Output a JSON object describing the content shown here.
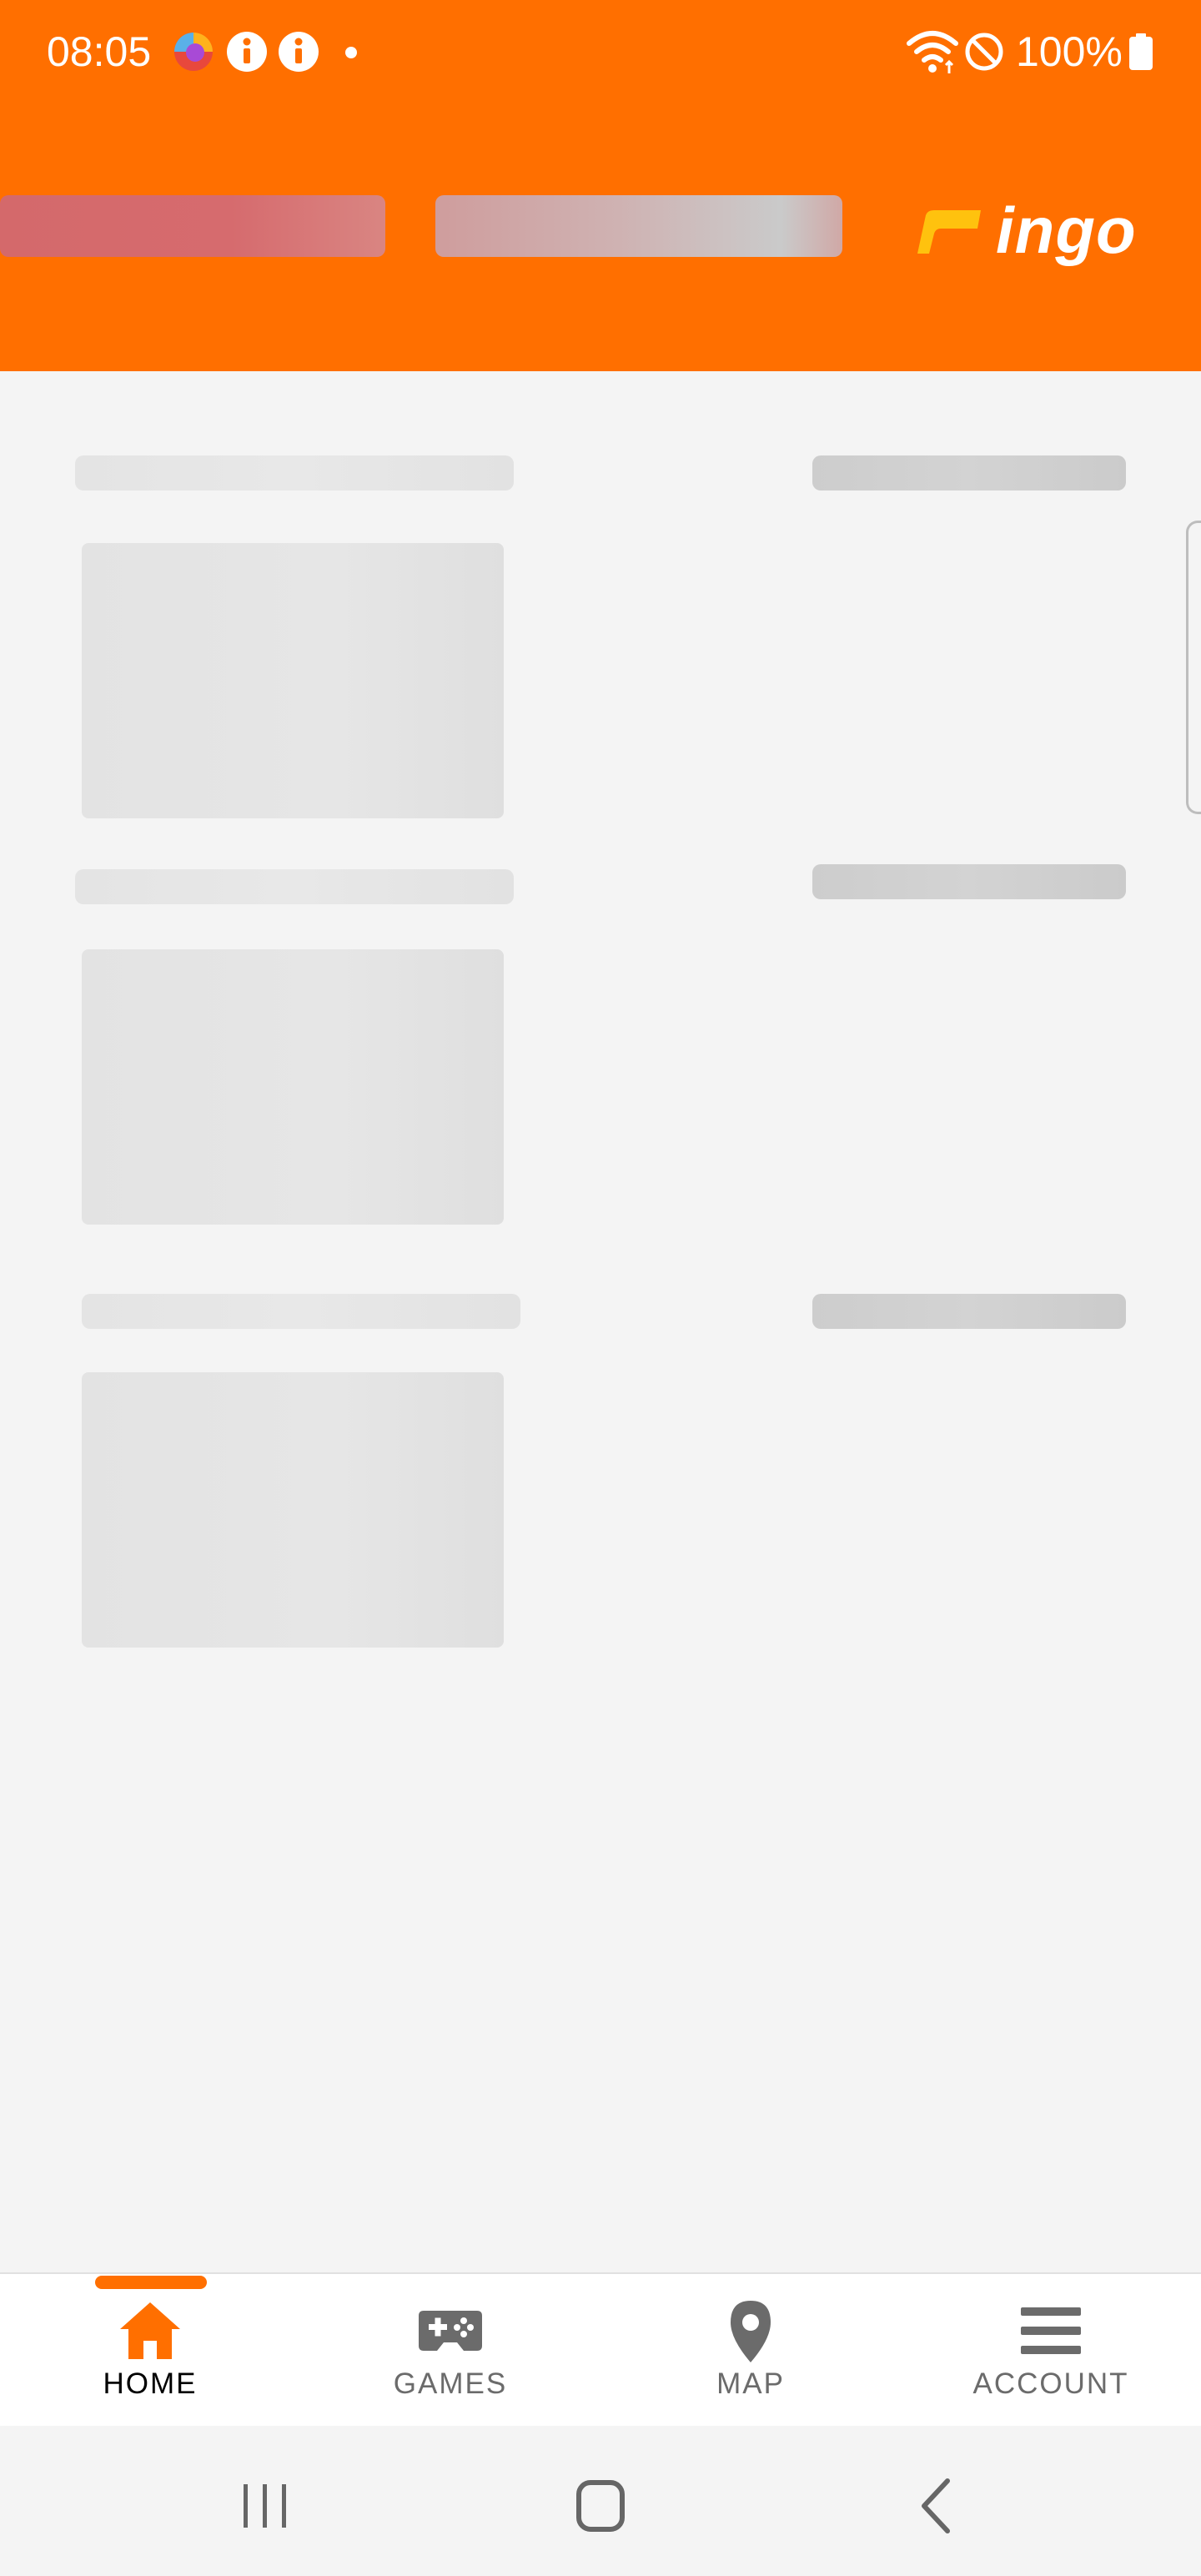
{
  "status_bar": {
    "time": "08:05",
    "battery": "100%",
    "icons": [
      "firefox-icon",
      "info-icon",
      "info-icon",
      "notification-dot",
      "wifi-icon",
      "do-not-disturb-icon",
      "battery-icon"
    ]
  },
  "header": {
    "logo_text": "ingo",
    "background_color": "#ff6f00",
    "logo_accent_color": "#ffc20e"
  },
  "bottom_nav": {
    "items": [
      {
        "label": "HOME",
        "icon": "home-icon",
        "active": true
      },
      {
        "label": "GAMES",
        "icon": "gamepad-icon",
        "active": false
      },
      {
        "label": "MAP",
        "icon": "map-pin-icon",
        "active": false
      },
      {
        "label": "ACCOUNT",
        "icon": "menu-icon",
        "active": false
      }
    ],
    "active_color": "#ff6f00",
    "inactive_color": "#6b6b6b"
  },
  "system_nav": {
    "buttons": [
      "recent-apps-icon",
      "home-button-icon",
      "back-icon"
    ]
  }
}
